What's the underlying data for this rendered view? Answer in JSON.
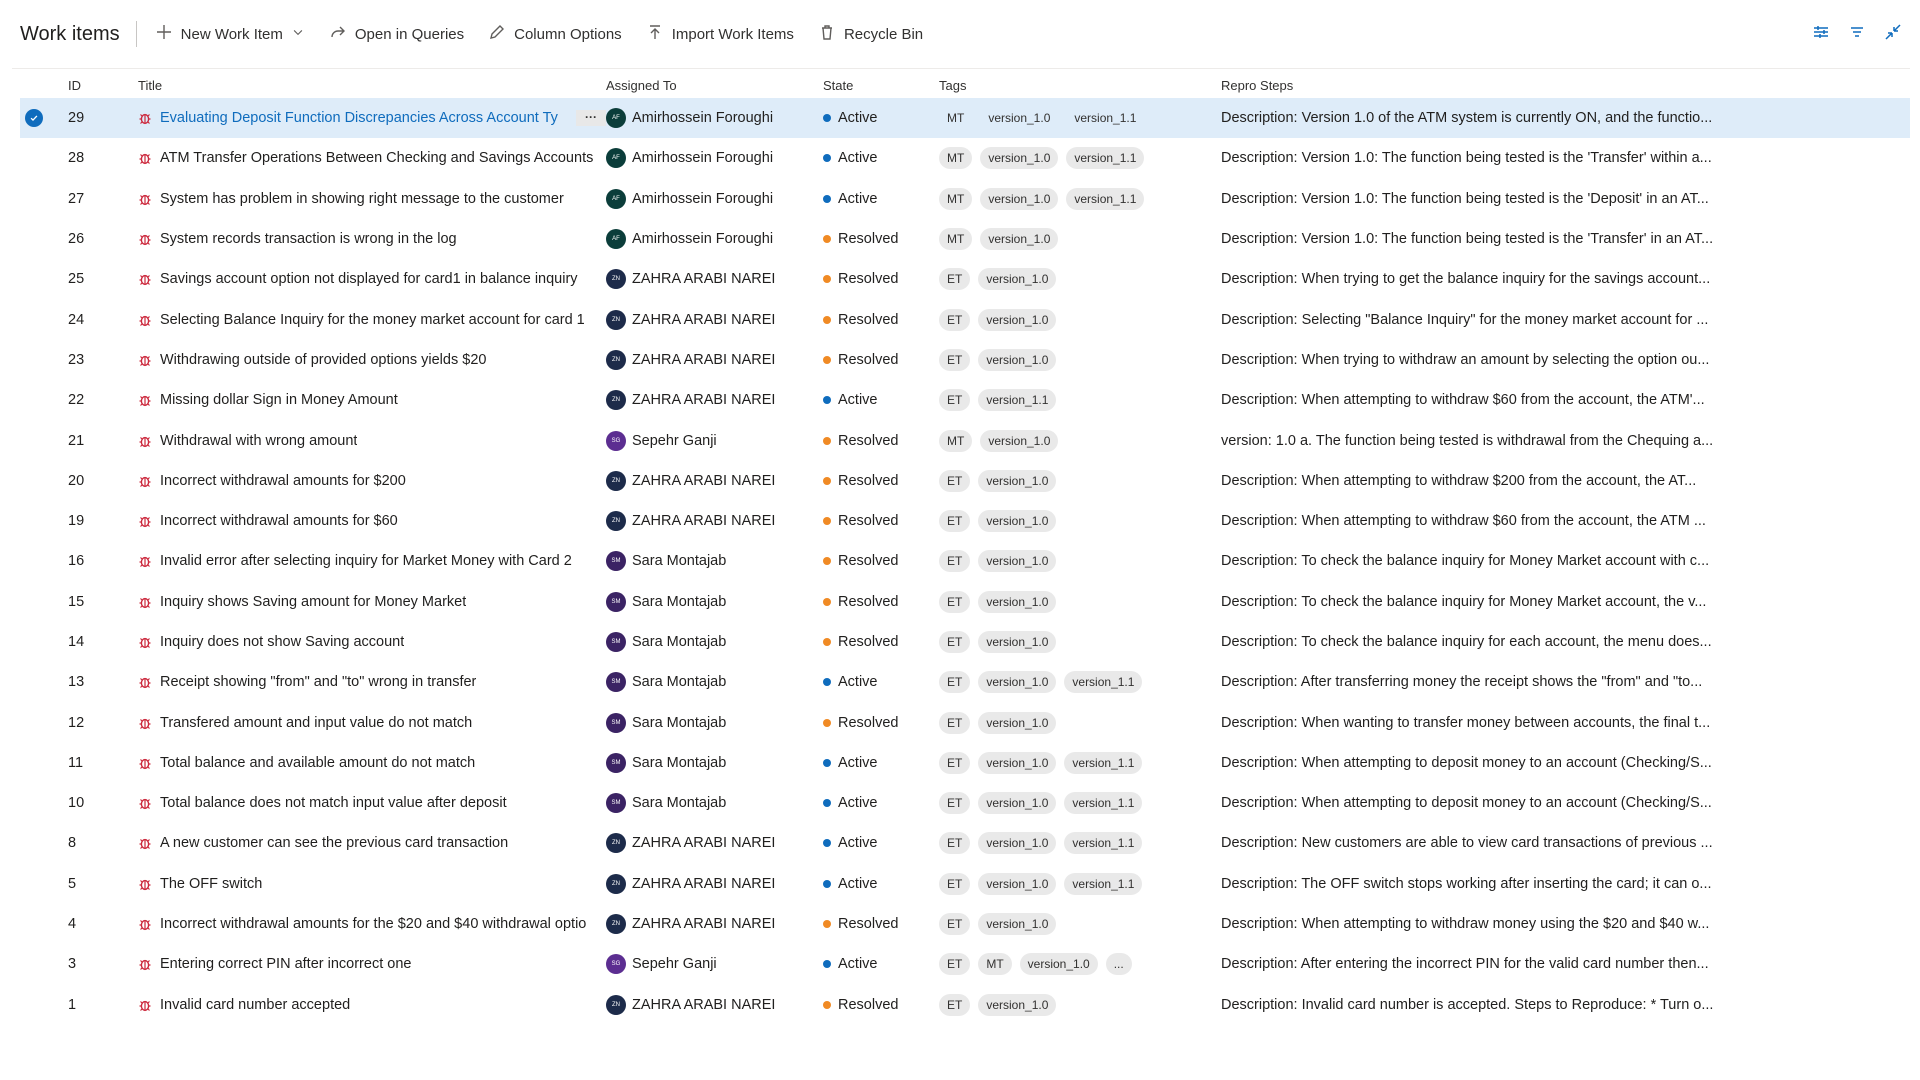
{
  "toolbar": {
    "title": "Work items",
    "new_work_item": "New Work Item",
    "open_in_queries": "Open in Queries",
    "column_options": "Column Options",
    "import_work_items": "Import Work Items",
    "recycle_bin": "Recycle Bin"
  },
  "columns": {
    "id": "ID",
    "title": "Title",
    "assigned_to": "Assigned To",
    "state": "State",
    "tags": "Tags",
    "repro_steps": "Repro Steps"
  },
  "colors": {
    "accent": "#0f6cbd",
    "selected_row": "#deecf9",
    "active_state": "#0f6cbd",
    "resolved_state": "#f08a24",
    "bug_icon": "#cc293d"
  },
  "icons": {
    "work_item_type": "bug-icon",
    "selection": "checkmark-circle-icon",
    "row_menu": "more-actions-icon"
  },
  "rows": [
    {
      "id": "29",
      "title": "Evaluating Deposit Function Discrepancies Across Account Ty",
      "assignee": "Amirhossein Foroughi",
      "initials": "AF",
      "av": "af",
      "state": "Active",
      "tags": [
        "MT",
        "version_1.0",
        "version_1.1"
      ],
      "repro": "Description: Version 1.0 of the ATM system is currently ON, and the functio...",
      "selected": true,
      "more": "···"
    },
    {
      "id": "28",
      "title": "ATM Transfer Operations Between Checking and Savings Accounts",
      "assignee": "Amirhossein Foroughi",
      "initials": "AF",
      "av": "af",
      "state": "Active",
      "tags": [
        "MT",
        "version_1.0",
        "version_1.1"
      ],
      "repro": "Description: Version 1.0: The function being tested is the 'Transfer' within a..."
    },
    {
      "id": "27",
      "title": "System has problem in showing right message to the customer",
      "assignee": "Amirhossein Foroughi",
      "initials": "AF",
      "av": "af",
      "state": "Active",
      "tags": [
        "MT",
        "version_1.0",
        "version_1.1"
      ],
      "repro": "Description: Version 1.0: The function being tested is the 'Deposit' in an AT..."
    },
    {
      "id": "26",
      "title": "System records transaction is wrong in the log",
      "assignee": "Amirhossein Foroughi",
      "initials": "AF",
      "av": "af",
      "state": "Resolved",
      "tags": [
        "MT",
        "version_1.0"
      ],
      "repro": "Description: Version 1.0: The function being tested is the 'Transfer' in an AT..."
    },
    {
      "id": "25",
      "title": "Savings account option not displayed for card1 in balance inquiry",
      "assignee": "ZAHRA ARABI NAREI",
      "initials": "ZN",
      "av": "zn",
      "state": "Resolved",
      "tags": [
        "ET",
        "version_1.0"
      ],
      "repro": "Description: When trying to get the balance inquiry for the savings account..."
    },
    {
      "id": "24",
      "title": "Selecting Balance Inquiry for the money market account for card 1",
      "assignee": "ZAHRA ARABI NAREI",
      "initials": "ZN",
      "av": "zn",
      "state": "Resolved",
      "tags": [
        "ET",
        "version_1.0"
      ],
      "repro": "Description: Selecting \"Balance Inquiry\" for the money market account for ..."
    },
    {
      "id": "23",
      "title": "Withdrawing outside of provided options yields $20",
      "assignee": "ZAHRA ARABI NAREI",
      "initials": "ZN",
      "av": "zn",
      "state": "Resolved",
      "tags": [
        "ET",
        "version_1.0"
      ],
      "repro": "Description: When trying to withdraw an amount by selecting the option ou..."
    },
    {
      "id": "22",
      "title": "Missing dollar Sign in Money Amount",
      "assignee": "ZAHRA ARABI NAREI",
      "initials": "ZN",
      "av": "zn",
      "state": "Active",
      "tags": [
        "ET",
        "version_1.1"
      ],
      "repro": "Description: When attempting to withdraw $60 from the account, the ATM'..."
    },
    {
      "id": "21",
      "title": "Withdrawal with wrong amount",
      "assignee": "Sepehr Ganji",
      "initials": "SG",
      "av": "sg",
      "state": "Resolved",
      "tags": [
        "MT",
        "version_1.0"
      ],
      "repro": "version: 1.0 a. The function being tested is withdrawal from the Chequing a..."
    },
    {
      "id": "20",
      "title": "Incorrect withdrawal amounts for $200",
      "assignee": "ZAHRA ARABI NAREI",
      "initials": "ZN",
      "av": "zn",
      "state": "Resolved",
      "tags": [
        "ET",
        "version_1.0"
      ],
      "repro": "Description: When attempting to withdraw $200 from the account, the AT..."
    },
    {
      "id": "19",
      "title": "Incorrect withdrawal amounts for $60",
      "assignee": "ZAHRA ARABI NAREI",
      "initials": "ZN",
      "av": "zn",
      "state": "Resolved",
      "tags": [
        "ET",
        "version_1.0"
      ],
      "repro": "Description: When attempting to withdraw $60 from the account, the ATM ..."
    },
    {
      "id": "16",
      "title": "Invalid error after selecting inquiry for Market Money with Card 2",
      "assignee": "Sara Montajab",
      "initials": "SM",
      "av": "sm",
      "state": "Resolved",
      "tags": [
        "ET",
        "version_1.0"
      ],
      "repro": "Description: To check the balance inquiry for Money Market account with c..."
    },
    {
      "id": "15",
      "title": "Inquiry shows Saving amount for Money Market",
      "assignee": "Sara Montajab",
      "initials": "SM",
      "av": "sm",
      "state": "Resolved",
      "tags": [
        "ET",
        "version_1.0"
      ],
      "repro": "Description: To check the balance inquiry for Money Market account, the v..."
    },
    {
      "id": "14",
      "title": "Inquiry does not show Saving account",
      "assignee": "Sara Montajab",
      "initials": "SM",
      "av": "sm",
      "state": "Resolved",
      "tags": [
        "ET",
        "version_1.0"
      ],
      "repro": "Description: To check the balance inquiry for each account, the menu does..."
    },
    {
      "id": "13",
      "title": "Receipt showing \"from\" and \"to\" wrong in transfer",
      "assignee": "Sara Montajab",
      "initials": "SM",
      "av": "sm",
      "state": "Active",
      "tags": [
        "ET",
        "version_1.0",
        "version_1.1"
      ],
      "repro": "Description: After transferring money the receipt shows the \"from\" and \"to..."
    },
    {
      "id": "12",
      "title": "Transfered amount and input value do not match",
      "assignee": "Sara Montajab",
      "initials": "SM",
      "av": "sm",
      "state": "Resolved",
      "tags": [
        "ET",
        "version_1.0"
      ],
      "repro": "Description: When wanting to transfer money between accounts, the final t..."
    },
    {
      "id": "11",
      "title": "Total balance and available amount do not match",
      "assignee": "Sara Montajab",
      "initials": "SM",
      "av": "sm",
      "state": "Active",
      "tags": [
        "ET",
        "version_1.0",
        "version_1.1"
      ],
      "repro": "Description: When attempting to deposit money to an account (Checking/S..."
    },
    {
      "id": "10",
      "title": "Total balance does not match input value after deposit",
      "assignee": "Sara Montajab",
      "initials": "SM",
      "av": "sm",
      "state": "Active",
      "tags": [
        "ET",
        "version_1.0",
        "version_1.1"
      ],
      "repro": "Description: When attempting to deposit money to an account (Checking/S..."
    },
    {
      "id": "8",
      "title": "A new customer can see the previous card transaction",
      "assignee": "ZAHRA ARABI NAREI",
      "initials": "ZN",
      "av": "zn",
      "state": "Active",
      "tags": [
        "ET",
        "version_1.0",
        "version_1.1"
      ],
      "repro": "Description: New customers are able to view card transactions of previous ..."
    },
    {
      "id": "5",
      "title": "The OFF switch",
      "assignee": "ZAHRA ARABI NAREI",
      "initials": "ZN",
      "av": "zn",
      "state": "Active",
      "tags": [
        "ET",
        "version_1.0",
        "version_1.1"
      ],
      "repro": "Description: The OFF switch stops working after inserting the card; it can o..."
    },
    {
      "id": "4",
      "title": "Incorrect withdrawal amounts for the $20 and $40 withdrawal optio",
      "assignee": "ZAHRA ARABI NAREI",
      "initials": "ZN",
      "av": "zn",
      "state": "Resolved",
      "tags": [
        "ET",
        "version_1.0"
      ],
      "repro": "Description: When attempting to withdraw money using the $20 and $40 w..."
    },
    {
      "id": "3",
      "title": "Entering correct PIN after incorrect one",
      "assignee": "Sepehr Ganji",
      "initials": "SG",
      "av": "sg",
      "state": "Active",
      "tags": [
        "ET",
        "MT",
        "version_1.0",
        "..."
      ],
      "repro": "Description: After entering the incorrect PIN for the valid card number then..."
    },
    {
      "id": "1",
      "title": "Invalid card number accepted",
      "assignee": "ZAHRA ARABI NAREI",
      "initials": "ZN",
      "av": "zn",
      "state": "Resolved",
      "tags": [
        "ET",
        "version_1.0"
      ],
      "repro": "Description: Invalid card number is accepted. Steps to Reproduce: * Turn o..."
    }
  ]
}
